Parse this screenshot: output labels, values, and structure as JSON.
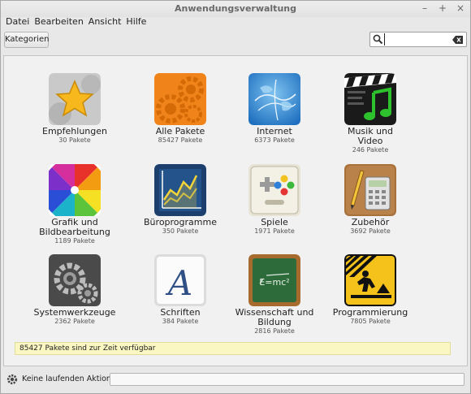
{
  "window": {
    "title": "Anwendungsverwaltung",
    "controls": [
      "–",
      "+",
      "×"
    ]
  },
  "menu": [
    "Datei",
    "Bearbeiten",
    "Ansicht",
    "Hilfe"
  ],
  "toolbar": {
    "categories_label": "Kategorien",
    "search_value": "",
    "search_placeholder": ""
  },
  "categories": [
    {
      "label": "Empfehlungen",
      "count": "30 Pakete",
      "icon": "star-icon"
    },
    {
      "label": "Alle Pakete",
      "count": "85427 Pakete",
      "icon": "gears-icon"
    },
    {
      "label": "Internet",
      "count": "6373 Pakete",
      "icon": "globe-icon"
    },
    {
      "label": "Musik und Video",
      "count": "246 Pakete",
      "icon": "music-video-icon"
    },
    {
      "label": "Grafik und Bildbearbeitung",
      "count": "1189 Pakete",
      "icon": "color-wheel-icon"
    },
    {
      "label": "Büroprogramme",
      "count": "350 Pakete",
      "icon": "office-chart-icon"
    },
    {
      "label": "Spiele",
      "count": "1971 Pakete",
      "icon": "gamepad-icon"
    },
    {
      "label": "Zubehör",
      "count": "3692 Pakete",
      "icon": "calculator-icon"
    },
    {
      "label": "Systemwerkzeuge",
      "count": "2362 Pakete",
      "icon": "system-gears-icon"
    },
    {
      "label": "Schriften",
      "count": "384 Pakete",
      "icon": "font-icon"
    },
    {
      "label": "Wissenschaft und Bildung",
      "count": "2816 Pakete",
      "icon": "chalkboard-icon"
    },
    {
      "label": "Programmierung",
      "count": "7805 Pakete",
      "icon": "construction-icon"
    }
  ],
  "status_message": "85427 Pakete sind zur Zeit verfügbar",
  "bottom": {
    "action_label": "Keine laufenden Aktionen"
  }
}
